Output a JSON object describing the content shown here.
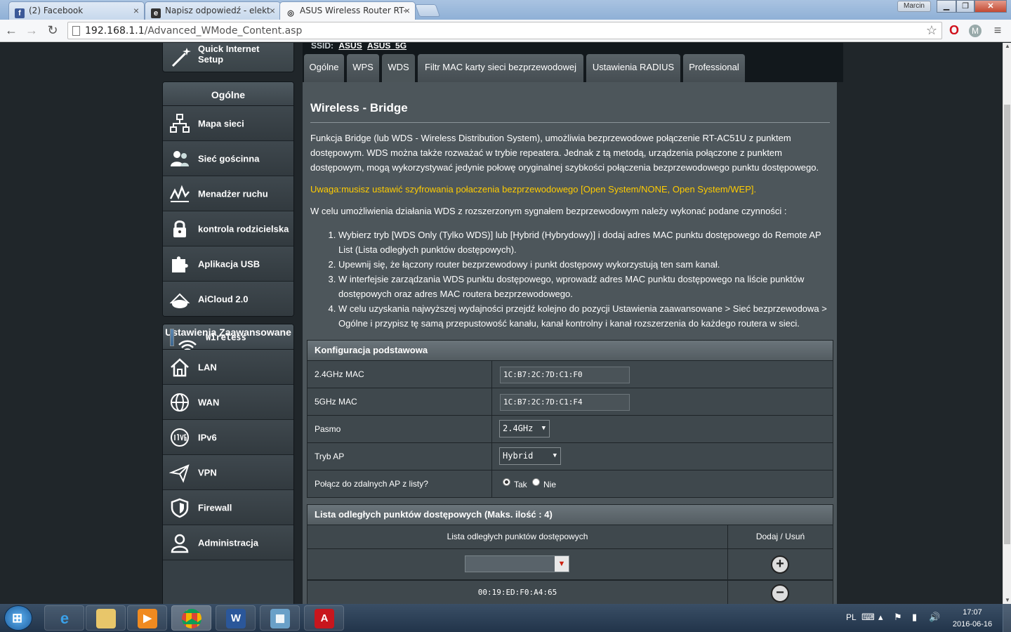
{
  "browser": {
    "tabs": [
      {
        "label": "(2) Facebook",
        "icon": "facebook-icon",
        "active": false
      },
      {
        "label": "Napisz odpowiedź - elekt",
        "icon": "edge-e-icon",
        "active": false
      },
      {
        "label": "ASUS Wireless Router RT-",
        "icon": "router-icon",
        "active": true
      }
    ],
    "user": "Marcin",
    "url_host": "192.168.1.1",
    "url_path": "/Advanced_WMode_Content.asp"
  },
  "sidebar": {
    "quick_setup": "Quick Internet Setup",
    "general_header": "Ogólne",
    "general_items": [
      {
        "label": "Mapa sieci",
        "icon": "network-map-icon"
      },
      {
        "label": "Sieć gościnna",
        "icon": "guest-network-icon"
      },
      {
        "label": "Menadżer ruchu",
        "icon": "traffic-manager-icon"
      },
      {
        "label": "kontrola rodzicielska",
        "icon": "parental-lock-icon"
      },
      {
        "label": "Aplikacja USB",
        "icon": "usb-puzzle-icon"
      },
      {
        "label": "AiCloud 2.0",
        "icon": "aicloud-icon"
      }
    ],
    "advanced_header": "Ustawienia Zaawansowane",
    "advanced_items": [
      {
        "label": "Wireless",
        "icon": "wifi-icon",
        "selected": true
      },
      {
        "label": "LAN",
        "icon": "home-lan-icon"
      },
      {
        "label": "WAN",
        "icon": "globe-wan-icon"
      },
      {
        "label": "IPv6",
        "icon": "ipv6-globe-icon"
      },
      {
        "label": "VPN",
        "icon": "vpn-icon"
      },
      {
        "label": "Firewall",
        "icon": "shield-firewall-icon"
      },
      {
        "label": "Administracja",
        "icon": "admin-user-icon"
      }
    ]
  },
  "header": {
    "ssid_label": "SSID:",
    "ssid_values": [
      "ASUS",
      "ASUS_5G"
    ]
  },
  "wireless_tabs": [
    "Ogólne",
    "WPS",
    "WDS",
    "Filtr MAC karty sieci bezprzewodowej",
    "Ustawienia RADIUS",
    "Professional"
  ],
  "active_tab": "WDS",
  "main": {
    "title": "Wireless - Bridge",
    "intro": "Funkcja Bridge (lub WDS - Wireless Distribution System), umożliwia bezprzewodowe połączenie RT-AC51U z punktem dostępowym. WDS można także rozważać w trybie repeatera. Jednak z tą metodą, urządzenia połączone z punktem dostępowym, mogą wykorzystywać jedynie połowę oryginalnej szybkości połączenia bezprzewodowego punktu dostępowego.",
    "warning": "Uwaga:musisz ustawić szyfrowania połaczenia bezprzewodowego [Open System/NONE, Open System/WEP].",
    "steps_intro": "W celu umożliwienia działania WDS z rozszerzonym sygnałem bezprzewodowym należy wykonać podane czynności :",
    "steps": [
      "Wybierz tryb [WDS Only (Tylko WDS)] lub [Hybrid (Hybrydowy)] i dodaj adres MAC punktu dostępowego do Remote AP List (Lista odległych punktów dostępowych).",
      "Upewnij się, że łączony router bezprzewodowy i punkt dostępowy wykorzystują ten sam kanał.",
      "W interfejsie zarządzania WDS punktu dostępowego, wprowadź adres MAC punktu dostępowego na liście punktów dostępowych oraz adres MAC routera bezprzewodowego.",
      "W celu uzyskania najwyższej wydajności przejdź kolejno do pozycji Ustawienia zaawansowane > Sieć bezprzewodowa > Ogólne i przypisz tę samą przepustowość kanału, kanał kontrolny i kanał rozszerzenia do każdego routera w sieci."
    ]
  },
  "config": {
    "header": "Konfiguracja podstawowa",
    "mac24_label": "2.4GHz MAC",
    "mac24_value": "1C:B7:2C:7D:C1:F0",
    "mac5_label": "5GHz MAC",
    "mac5_value": "1C:B7:2C:7D:C1:F4",
    "band_label": "Pasmo",
    "band_value": "2.4GHz",
    "apmode_label": "Tryb AP",
    "apmode_value": "Hybrid",
    "connect_label": "Połącz do zdalnych AP z listy?",
    "yes": "Tak",
    "no": "Nie",
    "connect_selected": "Tak"
  },
  "aplist": {
    "header": "Lista odległych punktów dostępowych (Maks. ilość : 4)",
    "col_list": "Lista odległych punktów dostępowych",
    "col_action": "Dodaj / Usuń",
    "add_input_value": "",
    "entries": [
      "00:19:ED:F0:A4:65"
    ]
  },
  "taskbar": {
    "apps": [
      "internet-explorer-icon",
      "file-explorer-icon",
      "media-player-icon",
      "chrome-icon",
      "word-icon",
      "control-panel-icon",
      "acrobat-icon"
    ],
    "lang": "PL",
    "time": "17:07",
    "date": "2016-06-16"
  },
  "colors": {
    "accent_selected": "#4a76a0",
    "warning_text": "#ffcc00",
    "panel_bg": "#4d565b"
  }
}
